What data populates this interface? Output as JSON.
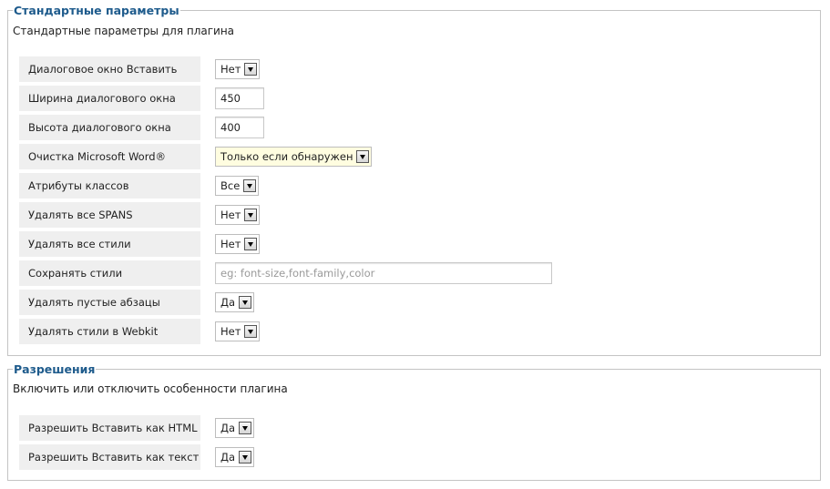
{
  "standard": {
    "legend": "Стандартные параметры",
    "description": "Стандартные параметры для плагина",
    "rows": [
      {
        "label": "Диалоговое окно Вставить",
        "value": "Нет"
      },
      {
        "label": "Ширина диалогового окна",
        "value": "450"
      },
      {
        "label": "Высота диалогового окна",
        "value": "400"
      },
      {
        "label": "Очистка Microsoft Word®",
        "value": "Только если обнаружен"
      },
      {
        "label": "Атрибуты классов",
        "value": "Все"
      },
      {
        "label": "Удалять все SPANS",
        "value": "Нет"
      },
      {
        "label": "Удалять все стили",
        "value": "Нет"
      },
      {
        "label": "Сохранять стили",
        "value": "",
        "placeholder": "eg: font-size,font-family,color"
      },
      {
        "label": "Удалять пустые абзацы",
        "value": "Да"
      },
      {
        "label": "Удалять стили в Webkit",
        "value": "Нет"
      }
    ]
  },
  "permissions": {
    "legend": "Разрешения",
    "description": "Включить или отключить особенности плагина",
    "rows": [
      {
        "label": "Разрешить Вставить как HTML",
        "value": "Да"
      },
      {
        "label": "Разрешить Вставить как текст",
        "value": "Да"
      }
    ]
  }
}
